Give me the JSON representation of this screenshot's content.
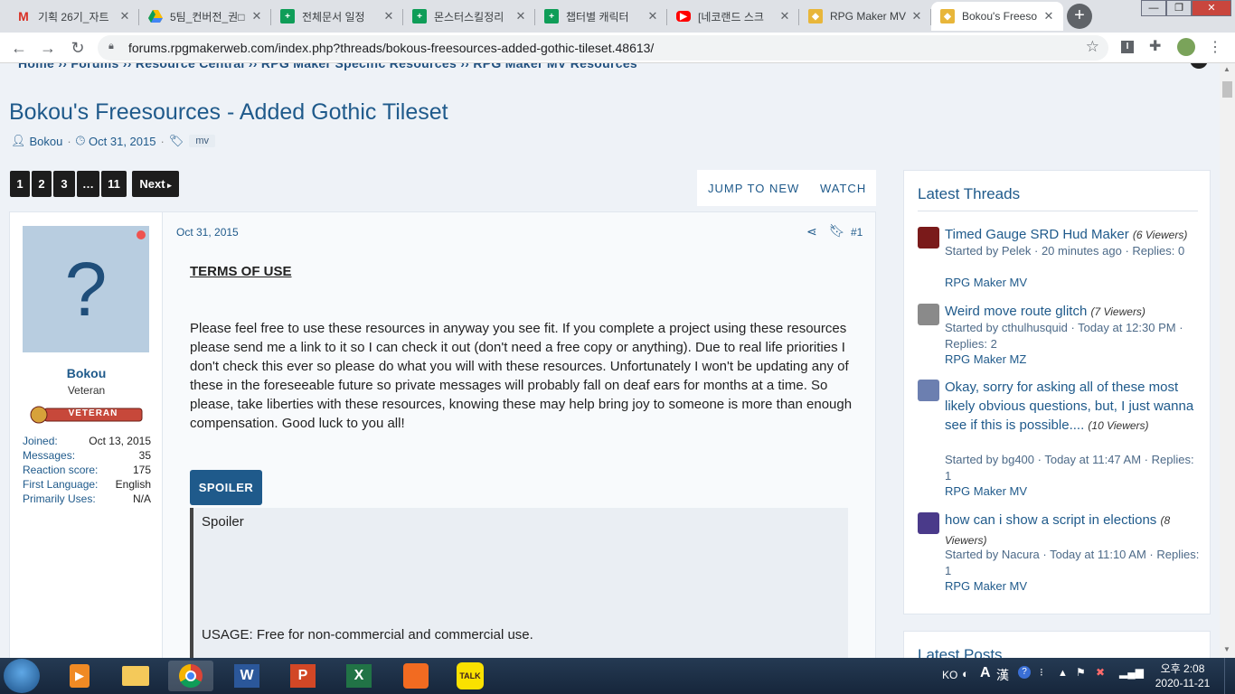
{
  "browser": {
    "tabs": [
      {
        "title": "기획 26기_자트",
        "icon": "gmail-icon"
      },
      {
        "title": "5팀_컨버전_권□",
        "icon": "drive-icon"
      },
      {
        "title": "전체문서 일정",
        "icon": "sheets-icon"
      },
      {
        "title": "몬스터스킬정리",
        "icon": "sheets-icon"
      },
      {
        "title": "챕터별 캐릭터",
        "icon": "sheets-icon"
      },
      {
        "title": "[네코랜드 스크",
        "icon": "youtube-icon"
      },
      {
        "title": "RPG Maker MV",
        "icon": "rpgmaker-icon"
      },
      {
        "title": "Bokou's Freeso",
        "icon": "rpgmaker-icon"
      }
    ],
    "url": "forums.rpgmakerweb.com/index.php?threads/bokous-freesources-added-gothic-tileset.48613/"
  },
  "thread": {
    "breadcrumb": "Home  ››  Forums  ››  Resource Central  ››  RPG Maker Specific Resources  ››  RPG Maker MV Resources",
    "title": "Bokou's Freesources - Added Gothic Tileset",
    "author": "Bokou",
    "date": "Oct 31, 2015",
    "tag": "mv",
    "pages": [
      "1",
      "2",
      "3",
      "…",
      "11"
    ],
    "next_label": "Next",
    "jump_label": "JUMP TO NEW",
    "watch_label": "WATCH"
  },
  "post": {
    "user": {
      "name": "Bokou",
      "title": "Veteran",
      "banner": "VETERAN",
      "avatar_char": "?"
    },
    "stats": [
      {
        "label": "Joined:",
        "value": "Oct 13, 2015"
      },
      {
        "label": "Messages:",
        "value": "35"
      },
      {
        "label": "Reaction score:",
        "value": "175"
      },
      {
        "label": "First Language:",
        "value": "English"
      },
      {
        "label": "Primarily Uses:",
        "value": "N/A"
      }
    ],
    "date": "Oct 31, 2015",
    "number": "#1",
    "terms_heading": "TERMS OF USE",
    "paragraph": "Please feel free to use these resources in anyway you see fit. If you complete a project using these resources please send me a link to it so I can check it out (don't need a free copy or anything). Due to real life priorities I don't check this ever so please do what you will with these resources. Unfortunately I won't be updating any of these in the foreseeable future so private messages will probably fall on deaf ears for months at a time. So please, take liberties with these resources, knowing these may help bring joy to someone is more than enough compensation. Good luck to you all!",
    "spoiler_button": "SPOILER",
    "spoiler_title": "Spoiler",
    "usage": "USAGE: Free for non-commercial and commercial use."
  },
  "sidebar": {
    "heading": "Latest Threads",
    "threads": [
      {
        "title": "Timed Gauge SRD Hud Maker",
        "viewers": "(6 Viewers)",
        "meta": "Started by Pelek · 20 minutes ago · Replies: 0",
        "forum": "RPG Maker MV",
        "avatar_color": "#7a1a1a"
      },
      {
        "title": "Weird move route glitch",
        "viewers": "(7 Viewers)",
        "meta": "Started by cthulhusquid · Today at 12:30 PM · Replies: 2",
        "forum": "RPG Maker MZ",
        "avatar_color": "#8a8a8a"
      },
      {
        "title": "Okay, sorry for asking all of these most likely obvious questions, but, I just wanna see if this is possible....",
        "viewers": "(10 Viewers)",
        "meta": "Started by bg400 · Today at 11:47 AM · Replies: 1",
        "forum": "RPG Maker MV",
        "avatar_color": "#6c7fb0"
      },
      {
        "title": "how can i show a script in elections",
        "viewers": "(8 Viewers)",
        "meta": "Started by Nacura · Today at 11:10 AM · Replies: 1",
        "forum": "RPG Maker MV",
        "avatar_color": "#4a3a8a"
      }
    ],
    "second_heading": "Latest Posts"
  },
  "taskbar": {
    "apps": [
      "start-orb",
      "media-player-icon",
      "file-explorer-icon",
      "chrome-icon",
      "word-icon",
      "powerpoint-icon",
      "excel-icon",
      "cat-app-icon",
      "kakaotalk-icon"
    ],
    "lang": "KO",
    "ime": "漢",
    "time": "오후 2:08",
    "date": "2020-11-21"
  }
}
